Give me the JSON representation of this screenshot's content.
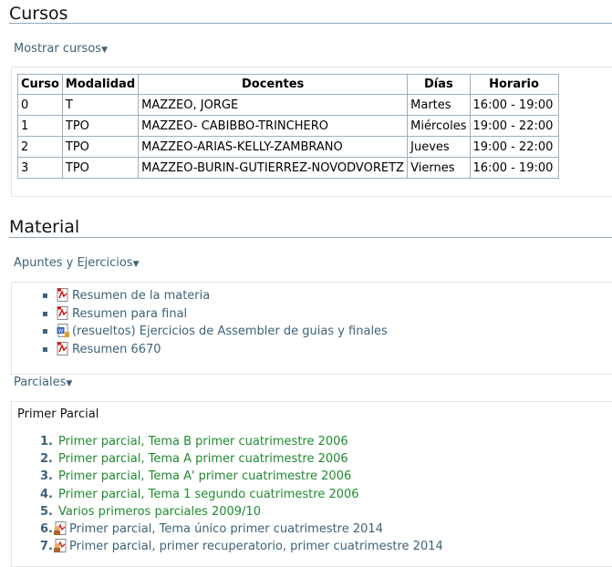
{
  "cursos": {
    "heading": "Cursos",
    "toggle_label": "Mostrar cursos",
    "table": {
      "headers": [
        "Curso",
        "Modalidad",
        "Docentes",
        "Días",
        "Horario"
      ],
      "rows": [
        [
          "0",
          "T",
          "MAZZEO, JORGE",
          "Martes",
          "16:00 - 19:00"
        ],
        [
          "1",
          "TPO",
          "MAZZEO- CABIBBO-TRINCHERO",
          "Miércoles",
          "19:00 - 22:00"
        ],
        [
          "2",
          "TPO",
          "MAZZEO-ARIAS-KELLY-ZAMBRANO",
          "Jueves",
          "19:00 - 22:00"
        ],
        [
          "3",
          "TPO",
          "MAZZEO-BURIN-GUTIERREZ-NOVODVORETZ",
          "Viernes",
          "16:00 - 19:00"
        ]
      ]
    }
  },
  "material": {
    "heading": "Material",
    "apuntes": {
      "toggle_label": "Apuntes y Ejercicios",
      "files": [
        {
          "label": "Resumen de la materia",
          "icon": "pdf-icon"
        },
        {
          "label": "Resumen para final",
          "icon": "pdf-icon"
        },
        {
          "label": "(resueltos) Ejercicios de Assembler de guias y finales",
          "icon": "word-doc-icon"
        },
        {
          "label": "Resumen 6670",
          "icon": "pdf-icon"
        }
      ]
    },
    "parciales": {
      "toggle_label": "Parciales",
      "subheading": "Primer Parcial",
      "items": [
        {
          "num": "1.",
          "label": "Primer parcial, Tema B primer cuatrimestre 2006"
        },
        {
          "num": "2.",
          "label": "Primer parcial, Tema A primer cuatrimestre 2006"
        },
        {
          "num": "3.",
          "label": "Primer parcial, Tema A' primer cuatrimestre 2006"
        },
        {
          "num": "4.",
          "label": "Primer parcial, Tema 1 segundo cuatrimestre 2006"
        },
        {
          "num": "5.",
          "label": "Varios primeros parciales 2009/10"
        },
        {
          "num": "6.",
          "label": "Primer parcial, Tema único primer cuatrimestre 2014",
          "icon": "pdf-user-icon"
        },
        {
          "num": "7.",
          "label": "Primer parcial, primer recuperatorio, primer cuatrimestre 2014",
          "icon": "pdf-user-icon"
        }
      ]
    }
  },
  "colors": {
    "link_blue": "#3d6278",
    "link_green": "#1f8a2f",
    "rule": "#8fa6b6"
  }
}
